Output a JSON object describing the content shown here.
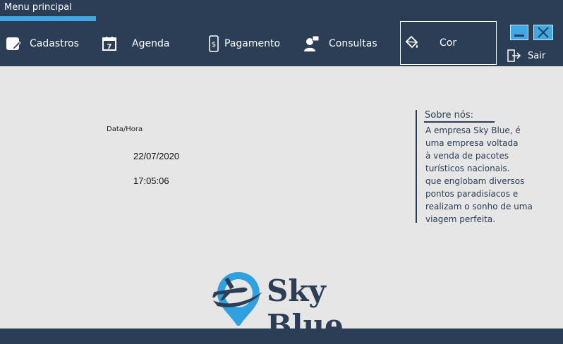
{
  "window": {
    "title": "Menu principal"
  },
  "menu": {
    "items": [
      {
        "label": "Cadastros",
        "icon": "edit-icon"
      },
      {
        "label": "Agenda",
        "icon": "calendar-icon"
      },
      {
        "label": "Pagamento",
        "icon": "phone-payment-icon"
      },
      {
        "label": "Consultas",
        "icon": "user-consult-icon"
      },
      {
        "label": "Cor",
        "icon": "paint-bucket-icon"
      }
    ],
    "calendar_day": "7"
  },
  "controls": {
    "minimize": "minimize",
    "close": "close",
    "exit_label": "Sair"
  },
  "datetime": {
    "label": "Data/Hora",
    "date": "22/07/2020",
    "time": "17:05:06"
  },
  "about": {
    "title": "Sobre nós:",
    "text": "A empresa Sky Blue, é\numa empresa voltada\nà venda de pacotes\nturísticos nacionais.\nque englobam diversos\npontos paradisíacos e\nrealizam o sonho de uma\nviagem perfeita."
  },
  "logo": {
    "text": "Sky Blue"
  },
  "colors": {
    "primary": "#2b3e55",
    "accent": "#3fa9e6",
    "background": "#e6e6e6"
  }
}
